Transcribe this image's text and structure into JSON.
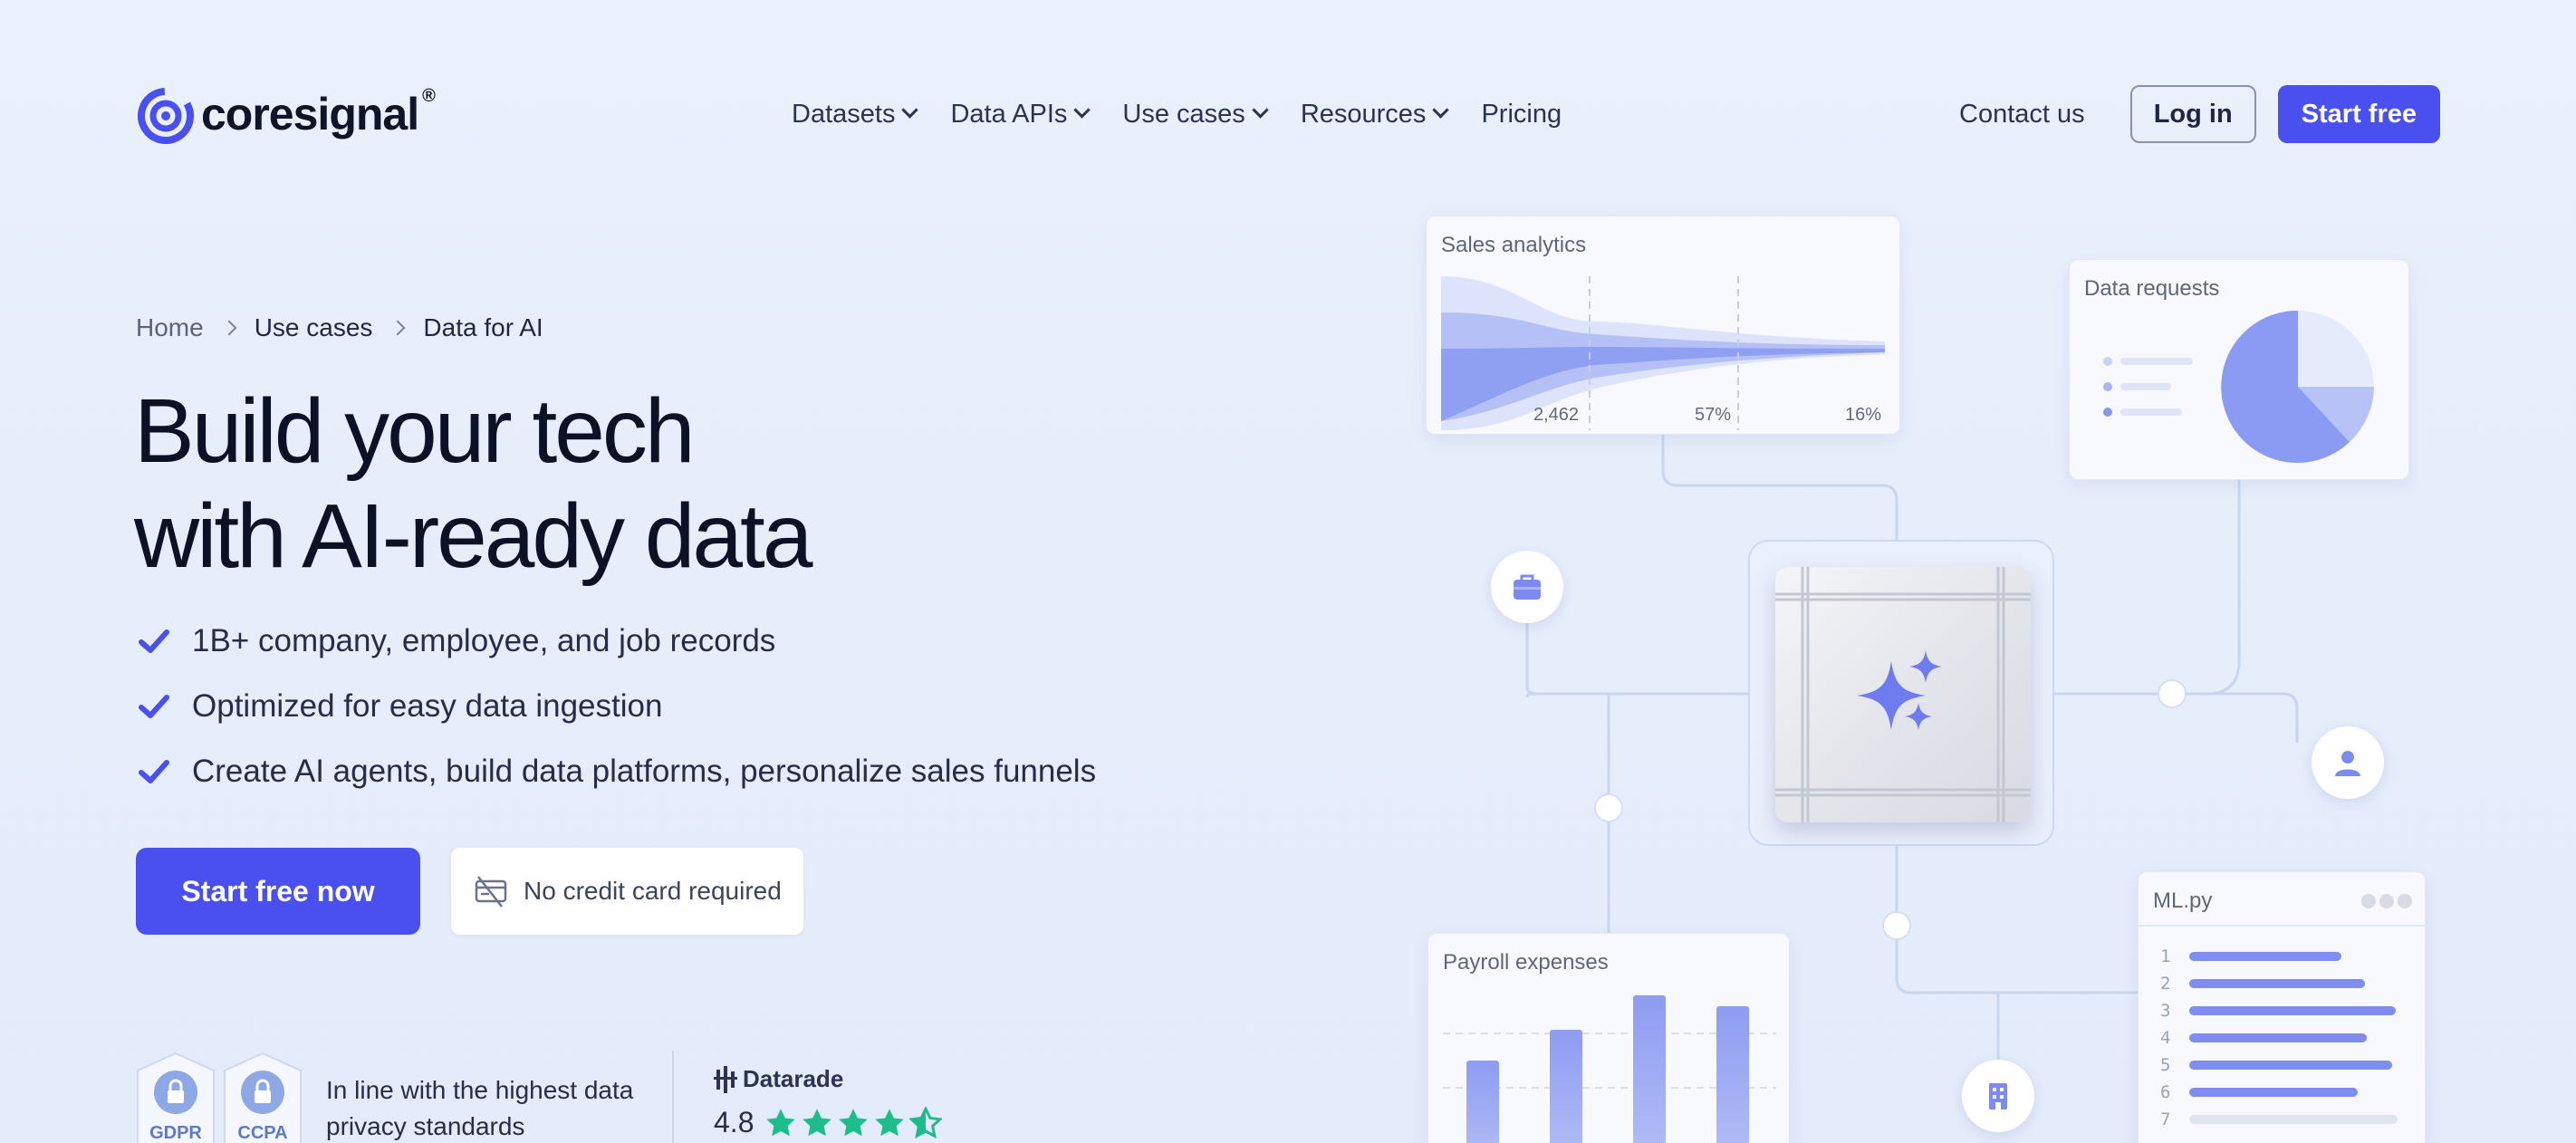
{
  "brand": {
    "name": "coresignal",
    "reg_mark": "®",
    "accent": "#4a4ff0"
  },
  "nav": {
    "items": [
      {
        "label": "Datasets",
        "dropdown": true
      },
      {
        "label": "Data APIs",
        "dropdown": true
      },
      {
        "label": "Use cases",
        "dropdown": true
      },
      {
        "label": "Resources",
        "dropdown": true
      },
      {
        "label": "Pricing",
        "dropdown": false
      }
    ],
    "contact": "Contact us",
    "login": "Log in",
    "start": "Start free"
  },
  "breadcrumb": [
    "Home",
    "Use cases",
    "Data for AI"
  ],
  "hero": {
    "title_line1": "Build your tech",
    "title_line2": "with AI-ready data",
    "bullets": [
      "1B+ company, employee, and job records",
      "Optimized for easy data ingestion",
      "Create AI agents, build data platforms, personalize sales funnels"
    ],
    "cta": "Start free now",
    "no_card": "No credit card required"
  },
  "trust": {
    "badges": [
      "GDPR",
      "CCPA"
    ],
    "text": "In line with the highest data privacy standards",
    "review_site": "Datarade",
    "rating": "4.8",
    "stars": 4.5
  },
  "illustration": {
    "sales": {
      "title": "Sales analytics",
      "values": [
        "2,462",
        "57%",
        "16%"
      ]
    },
    "requests": {
      "title": "Data requests"
    },
    "payroll": {
      "title": "Payroll expenses"
    },
    "ml": {
      "title": "ML.py",
      "lines": [
        "1",
        "2",
        "3",
        "4",
        "5",
        "6",
        "7"
      ]
    }
  }
}
